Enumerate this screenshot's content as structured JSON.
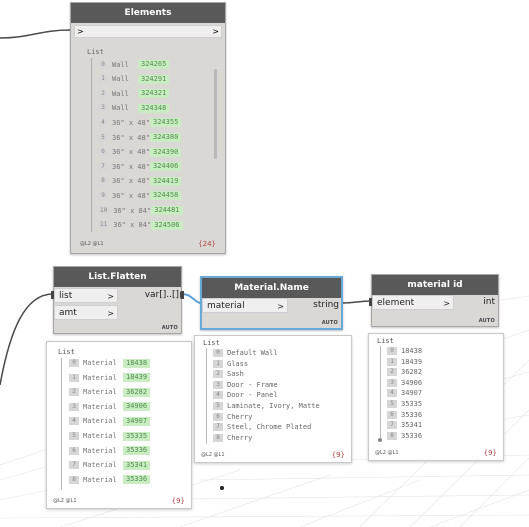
{
  "elements_node": {
    "title": "Elements",
    "preview_list_label": "List",
    "rows": [
      {
        "idx": "0",
        "type": "Wall",
        "id": "324265"
      },
      {
        "idx": "1",
        "type": "Wall",
        "id": "324291"
      },
      {
        "idx": "2",
        "type": "Wall",
        "id": "324321"
      },
      {
        "idx": "3",
        "type": "Wall",
        "id": "324348"
      },
      {
        "idx": "4",
        "type": "36\" x 48\"",
        "id": "324355"
      },
      {
        "idx": "5",
        "type": "36\" x 48\"",
        "id": "324380"
      },
      {
        "idx": "6",
        "type": "36\" x 48\"",
        "id": "324390"
      },
      {
        "idx": "7",
        "type": "36\" x 48\"",
        "id": "324406"
      },
      {
        "idx": "8",
        "type": "36\" x 48\"",
        "id": "324419"
      },
      {
        "idx": "9",
        "type": "36\" x 48\"",
        "id": "324458"
      },
      {
        "idx": "10",
        "type": "36\" x 84\"",
        "id": "324481"
      },
      {
        "idx": "11",
        "type": "36\" x 84\"",
        "id": "324506"
      }
    ],
    "footer_levels": "@L2 @L1",
    "footer_count": "{24}"
  },
  "flatten_node": {
    "title": "List.Flatten",
    "input_list": "list",
    "input_amt": "amt",
    "output": "var[]..[]",
    "auto": "AUTO",
    "preview_list_label": "List",
    "rows": [
      {
        "idx": "0",
        "label": "Material",
        "id": "18438"
      },
      {
        "idx": "1",
        "label": "Material",
        "id": "18439"
      },
      {
        "idx": "2",
        "label": "Material",
        "id": "36282"
      },
      {
        "idx": "3",
        "label": "Material",
        "id": "34906"
      },
      {
        "idx": "4",
        "label": "Material",
        "id": "34907"
      },
      {
        "idx": "5",
        "label": "Material",
        "id": "35335"
      },
      {
        "idx": "6",
        "label": "Material",
        "id": "35336"
      },
      {
        "idx": "7",
        "label": "Material",
        "id": "35341"
      },
      {
        "idx": "8",
        "label": "Material",
        "id": "35336"
      }
    ],
    "footer_levels": "@L2 @L1",
    "footer_count": "{9}"
  },
  "material_name_node": {
    "title": "Material.Name",
    "input": "material",
    "output": "string",
    "auto": "AUTO",
    "preview_list_label": "List",
    "rows": [
      {
        "idx": "0",
        "text": "Default Wall"
      },
      {
        "idx": "1",
        "text": "Glass"
      },
      {
        "idx": "2",
        "text": "Sash"
      },
      {
        "idx": "3",
        "text": "Door - Frame"
      },
      {
        "idx": "4",
        "text": "Door - Panel"
      },
      {
        "idx": "5",
        "text": "Laminate, Ivory, Matte"
      },
      {
        "idx": "6",
        "text": "Cherry"
      },
      {
        "idx": "7",
        "text": "Steel, Chrome Plated"
      },
      {
        "idx": "8",
        "text": "Cherry"
      }
    ],
    "footer_levels": "@L2 @L1",
    "footer_count": "{9}"
  },
  "material_id_node": {
    "title": "material id",
    "input": "element",
    "output": "int",
    "auto": "AUTO",
    "preview_list_label": "List",
    "rows": [
      {
        "idx": "0",
        "text": "18438"
      },
      {
        "idx": "1",
        "text": "18439"
      },
      {
        "idx": "2",
        "text": "36282"
      },
      {
        "idx": "3",
        "text": "34906"
      },
      {
        "idx": "4",
        "text": "34907"
      },
      {
        "idx": "5",
        "text": "35335"
      },
      {
        "idx": "6",
        "text": "35336"
      },
      {
        "idx": "7",
        "text": "35341"
      },
      {
        "idx": "8",
        "text": "35336"
      }
    ],
    "footer_levels": "@L2 @L1",
    "footer_count": "{9}"
  },
  "colors": {
    "node_header": "#595959",
    "node_body": "#dad8d5",
    "selected_border": "#6aa8d8",
    "wire": "#4a4a4a",
    "wire_selected": "#5aa0d8",
    "id_highlight": "#c9ecc3"
  }
}
